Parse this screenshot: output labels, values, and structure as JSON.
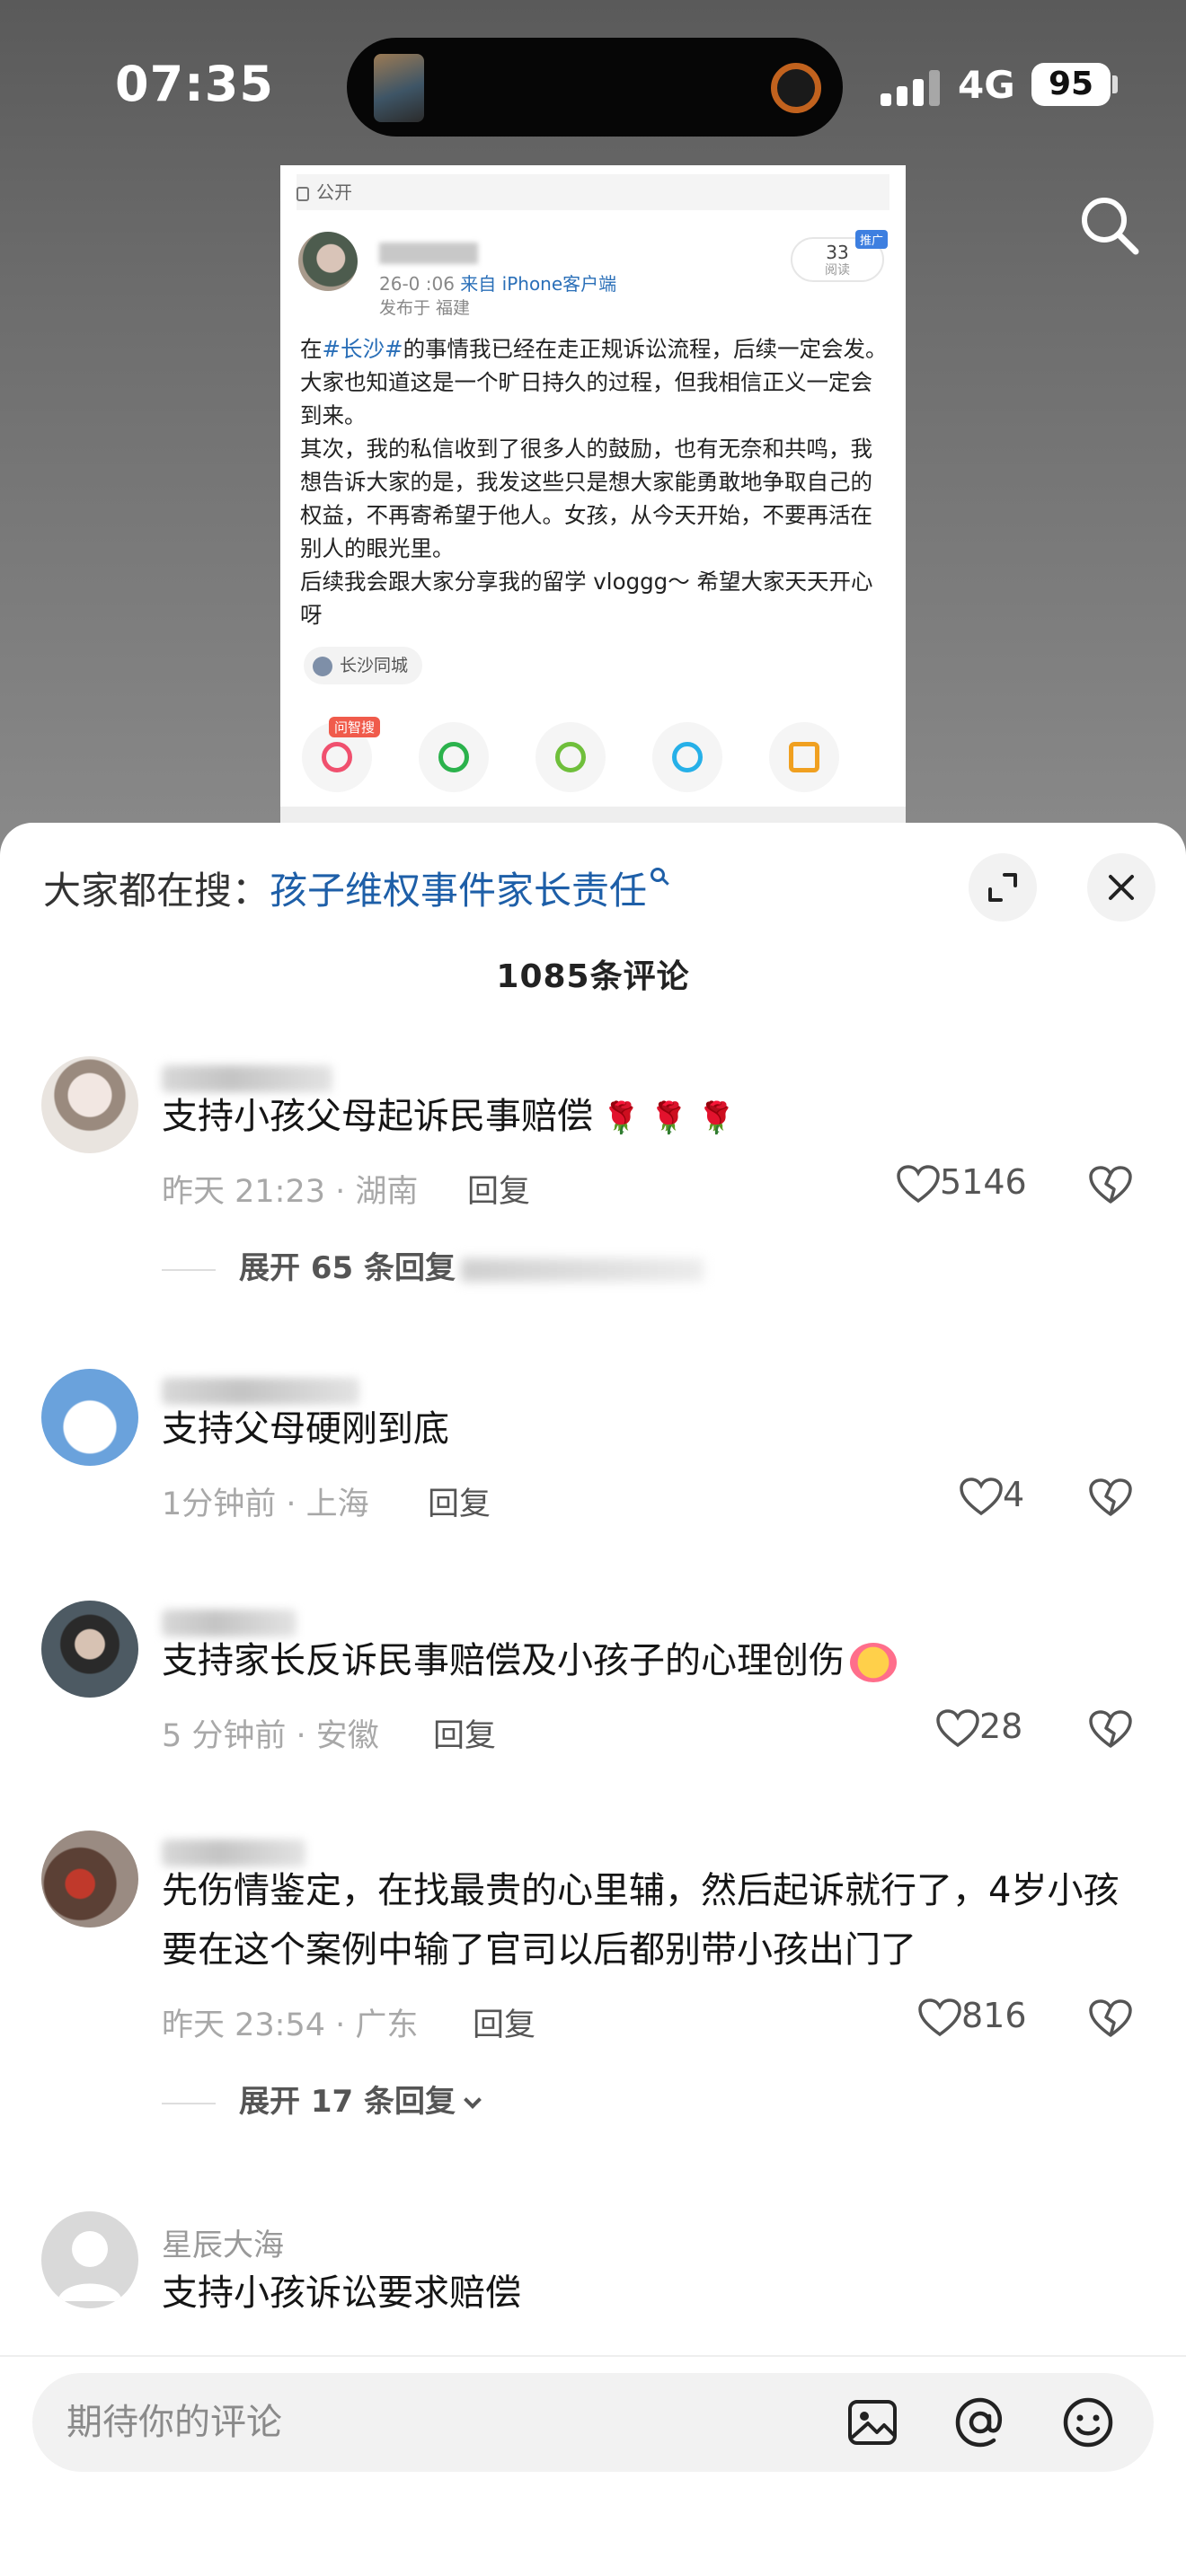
{
  "status_bar": {
    "time": "07:35",
    "network": "4G",
    "battery": "95"
  },
  "post": {
    "visibility": "公开",
    "meta_date": "26-0  :06",
    "meta_source": "来自 iPhone客户端",
    "location": "发布于 福建",
    "read_count": "33",
    "read_label": "阅读",
    "promo_tag": "推广",
    "body_prefix": "在",
    "body_hashtag": "#长沙#",
    "body_rest": "的事情我已经在走正规诉讼流程，后续一定会发。大家也知道这是一个旷日持久的过程，但我相信正义一定会到来。\n其次，我的私信收到了很多人的鼓励，也有无奈和共鸣，我想告诉大家的是，我发这些只是想大家能勇敢地争取自己的权益，不再寄希望于他人。女孩，从今天开始，不要再活在别人的眼光里。\n后续我会跟大家分享我的留学 vloggg～ 希望大家天天开心呀",
    "city_tag": "长沙同城",
    "ai_badge": "问智搜"
  },
  "sheet": {
    "hot_search_prefix": "大家都在搜：",
    "hot_search_keyword": "孩子维权事件家长责任",
    "comment_count": "1085条评论"
  },
  "comments": [
    {
      "name": "四二",
      "text": "支持小孩父母起诉民事赔偿",
      "time": "昨天 21:23 · 湖南",
      "reply": "回复",
      "likes": "5146",
      "expand": "展开 65 条回复"
    },
    {
      "name": "不会",
      "text": "支持父母硬刚到底",
      "time": "1分钟前 · 上海",
      "reply": "回复",
      "likes": "4"
    },
    {
      "name": "用户",
      "text": "支持家长反诉民事赔偿及小孩子的心理创伤",
      "time": "5 分钟前 · 安徽",
      "reply": "回复",
      "likes": "28"
    },
    {
      "name": "慢慢",
      "text": "先伤情鉴定，在找最贵的心里辅，然后起诉就行了，4岁小孩要在这个案例中输了官司以后都别带小孩出门了",
      "time": "昨天 23:54 · 广东",
      "reply": "回复",
      "likes": "816",
      "expand": "展开 17 条回复"
    },
    {
      "name": "星辰大海",
      "text": "支持小孩诉讼要求赔偿",
      "time": "",
      "reply": "",
      "likes": ""
    }
  ],
  "input": {
    "placeholder": "期待你的评论"
  },
  "colors": {
    "accent_blue": "#1e5fa8",
    "link_blue": "#2a6fb8",
    "badge_red": "#f05b4b"
  }
}
